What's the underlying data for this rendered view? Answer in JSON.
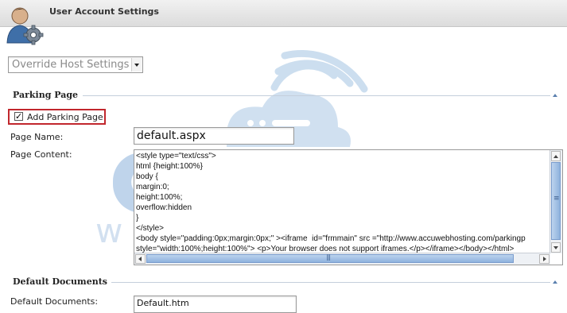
{
  "header": {
    "title": "User Account Settings",
    "icon": "user-settings-icon"
  },
  "host_settings": {
    "selected": "Override Host Settings"
  },
  "parking_page": {
    "section_title": "Parking Page",
    "add_parking_page": {
      "label": "Add Parking Page",
      "checked": true
    },
    "page_name_label": "Page Name:",
    "page_name_value": "default.aspx",
    "page_content_label": "Page Content:",
    "page_content_lines": [
      "<style type=\"text/css\">",
      "html {height:100%}",
      "body {",
      "margin:0;",
      "height:100%;",
      "overflow:hidden",
      "}",
      "</style>",
      "<body style=\"padding:0px;margin:0px;\" ><iframe  id=\"frmmain\" src =\"http://www.accuwebhosting.com/parkingp",
      "style=\"width:100%;height:100%\"> <p>Your browser does not support iframes.</p></iframe></body></html>"
    ]
  },
  "default_documents": {
    "section_title": "Default Documents",
    "label": "Default Documents:",
    "value": "Default.htm"
  },
  "colors": {
    "highlight_border": "#c1272d",
    "section_line": "#c4cfdc",
    "accent": "#5a7fae"
  }
}
